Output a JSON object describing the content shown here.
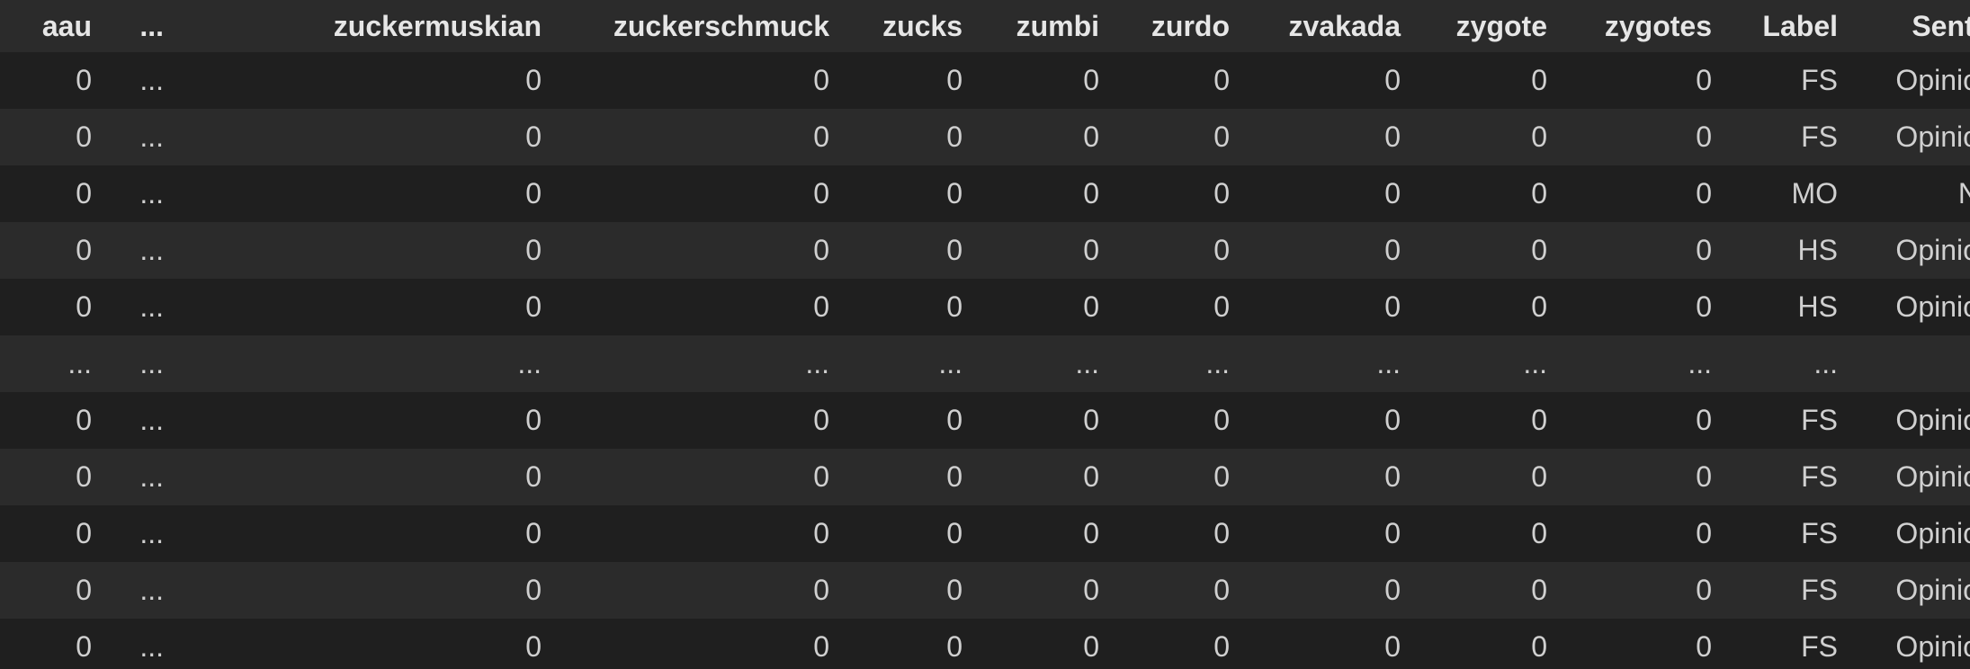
{
  "table": {
    "columns": [
      "aau",
      "...",
      "zuckermuskian",
      "zuckerschmuck",
      "zucks",
      "zumbi",
      "zurdo",
      "zvakada",
      "zygote",
      "zygotes",
      "Label",
      "Sentiment"
    ],
    "rows": [
      [
        "0",
        "...",
        "0",
        "0",
        "0",
        "0",
        "0",
        "0",
        "0",
        "0",
        "FS",
        "Opinionated"
      ],
      [
        "0",
        "...",
        "0",
        "0",
        "0",
        "0",
        "0",
        "0",
        "0",
        "0",
        "FS",
        "Opinionated"
      ],
      [
        "0",
        "...",
        "0",
        "0",
        "0",
        "0",
        "0",
        "0",
        "0",
        "0",
        "MO",
        "Neutral"
      ],
      [
        "0",
        "...",
        "0",
        "0",
        "0",
        "0",
        "0",
        "0",
        "0",
        "0",
        "HS",
        "Opinionated"
      ],
      [
        "0",
        "...",
        "0",
        "0",
        "0",
        "0",
        "0",
        "0",
        "0",
        "0",
        "HS",
        "Opinionated"
      ],
      [
        "...",
        "...",
        "...",
        "...",
        "...",
        "...",
        "...",
        "...",
        "...",
        "...",
        "...",
        "..."
      ],
      [
        "0",
        "...",
        "0",
        "0",
        "0",
        "0",
        "0",
        "0",
        "0",
        "0",
        "FS",
        "Opinionated"
      ],
      [
        "0",
        "...",
        "0",
        "0",
        "0",
        "0",
        "0",
        "0",
        "0",
        "0",
        "FS",
        "Opinionated"
      ],
      [
        "0",
        "...",
        "0",
        "0",
        "0",
        "0",
        "0",
        "0",
        "0",
        "0",
        "FS",
        "Opinionated"
      ],
      [
        "0",
        "...",
        "0",
        "0",
        "0",
        "0",
        "0",
        "0",
        "0",
        "0",
        "FS",
        "Opinionated"
      ],
      [
        "0",
        "...",
        "0",
        "0",
        "0",
        "0",
        "0",
        "0",
        "0",
        "0",
        "FS",
        "Opinionated"
      ]
    ]
  },
  "colors": {
    "background": "#1f1f1f",
    "header_background": "#2b2b2b",
    "row_alt_background": "#2b2b2b",
    "text": "#d0d0d0"
  }
}
